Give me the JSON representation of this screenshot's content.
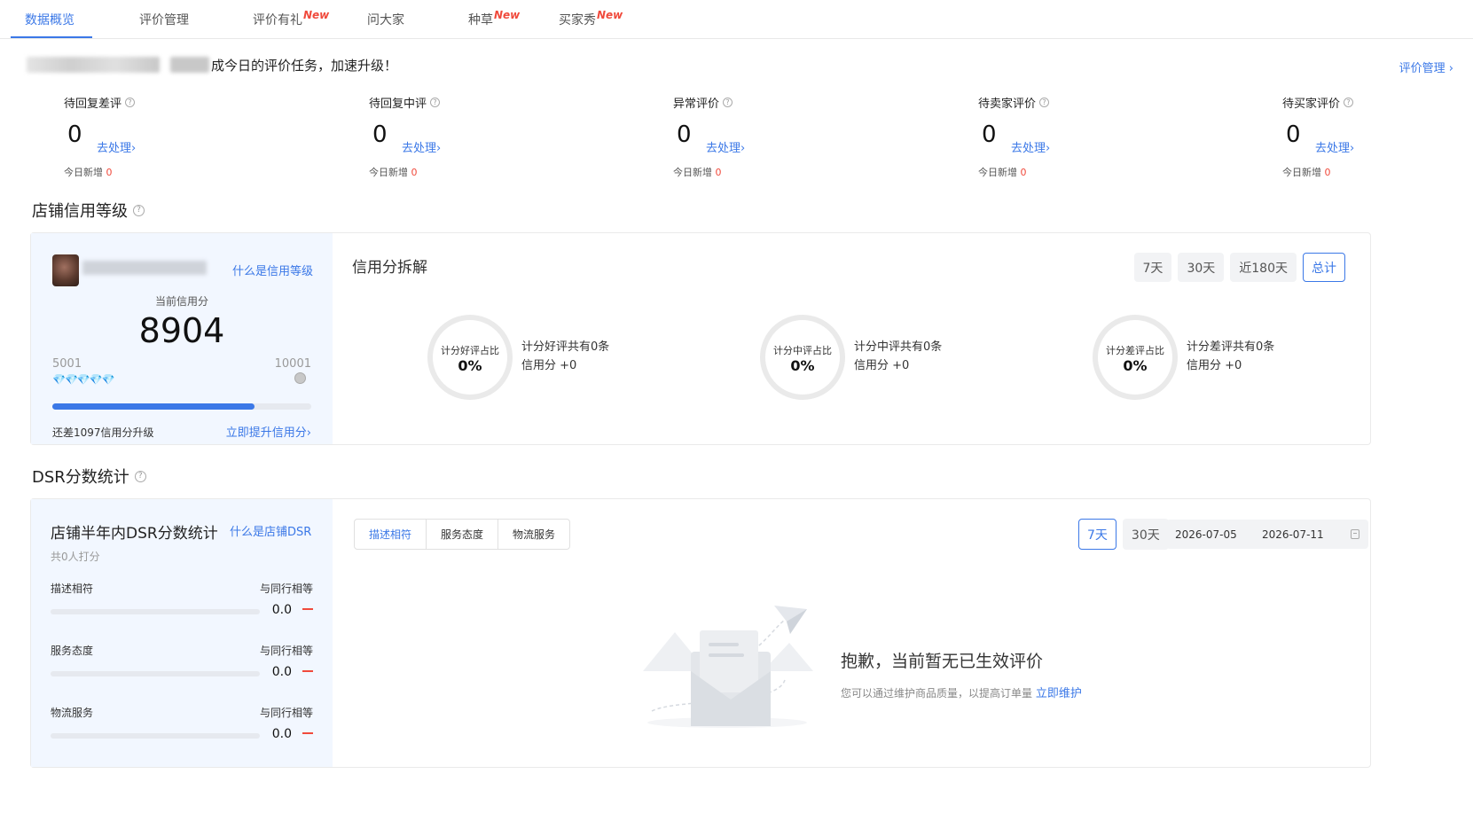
{
  "tabs": [
    {
      "label": "数据概览",
      "new": ""
    },
    {
      "label": "评价管理",
      "new": ""
    },
    {
      "label": "评价有礼",
      "new": "New"
    },
    {
      "label": "问大家",
      "new": ""
    },
    {
      "label": "种草",
      "new": "New"
    },
    {
      "label": "买家秀",
      "new": "New"
    }
  ],
  "task": {
    "text": "成今日的评价任务，加速升级！"
  },
  "header_link": "评价管理 ›",
  "stats": [
    {
      "label": "待回复差评",
      "value": "0",
      "go": "去处理›",
      "today_label": "今日新增",
      "today_value": "0"
    },
    {
      "label": "待回复中评",
      "value": "0",
      "go": "去处理›",
      "today_label": "今日新增",
      "today_value": "0"
    },
    {
      "label": "异常评价",
      "value": "0",
      "go": "去处理›",
      "today_label": "今日新增",
      "today_value": "0"
    },
    {
      "label": "待卖家评价",
      "value": "0",
      "go": "去处理›",
      "today_label": "今日新增",
      "today_value": "0"
    },
    {
      "label": "待买家评价",
      "value": "0",
      "go": "去处理›",
      "today_label": "今日新增",
      "today_value": "0"
    }
  ],
  "credit": {
    "section_title": "店铺信用等级",
    "what_link": "什么是信用等级",
    "current_label": "当前信用分",
    "score": "8904",
    "range_low": "5001",
    "range_high": "10001",
    "diamonds": "💎💎💎💎💎",
    "progress": 0.78,
    "lack_text": "还差1097信用分升级",
    "upgrade_link": "立即提升信用分›",
    "breakdown_title": "信用分拆解",
    "periods": [
      "7天",
      "30天",
      "近180天",
      "总计"
    ],
    "active_period": 3,
    "rings": [
      {
        "ring_label": "计分好评占比",
        "ring_value": "0%",
        "line1": "计分好评共有0条",
        "line2": "信用分 +0"
      },
      {
        "ring_label": "计分中评占比",
        "ring_value": "0%",
        "line1": "计分中评共有0条",
        "line2": "信用分 +0"
      },
      {
        "ring_label": "计分差评占比",
        "ring_value": "0%",
        "line1": "计分差评共有0条",
        "line2": "信用分 +0"
      }
    ]
  },
  "dsr": {
    "section_title": "DSR分数统计",
    "card_title": "店铺半年内DSR分数统计",
    "what_link": "什么是店铺DSR",
    "count_text": "共0人打分",
    "rows": [
      {
        "name": "描述相符",
        "compare": "与同行相等",
        "value": "0.0"
      },
      {
        "name": "服务态度",
        "compare": "与同行相等",
        "value": "0.0"
      },
      {
        "name": "物流服务",
        "compare": "与同行相等",
        "value": "0.0"
      }
    ],
    "segments": [
      "描述相符",
      "服务态度",
      "物流服务"
    ],
    "periods": [
      "7天",
      "30天"
    ],
    "date_start": "2026-07-05",
    "date_end": "2026-07-11",
    "empty_title": "抱歉，当前暂无已生效评价",
    "empty_sub": "您可以通过维护商品质量，以提高订单量",
    "empty_link": "立即维护"
  },
  "colors": {
    "accent": "#3b78e7",
    "danger": "#f04a3c"
  }
}
